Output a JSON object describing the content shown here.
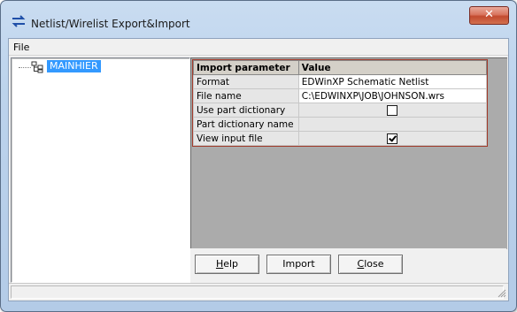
{
  "window": {
    "title": "Netlist/Wirelist Export&Import",
    "close_label": "✕"
  },
  "menu": {
    "items": [
      {
        "label": "File"
      }
    ]
  },
  "tree": {
    "nodes": [
      {
        "label": "MAINHIER",
        "selected": true,
        "icon": "hierarchy-icon"
      }
    ]
  },
  "grid": {
    "columns": [
      "Import parameter",
      "Value"
    ],
    "rows": [
      {
        "name": "Format",
        "value": "EDWinXP Schematic Netlist"
      },
      {
        "name": "File name",
        "value": "C:\\EDWINXP\\JOB\\JOHNSON.wrs"
      },
      {
        "name": "Use part dictionary",
        "checkbox": false
      },
      {
        "name": "Part dictionary name",
        "value": ""
      },
      {
        "name": "View input file",
        "checkbox": true
      }
    ]
  },
  "buttons": {
    "help": {
      "label": "Help",
      "mnemonic": "H",
      "rest": "elp"
    },
    "import": {
      "label": "Import"
    },
    "close": {
      "label": "Close",
      "mnemonic": "C",
      "rest": "lose"
    }
  },
  "colors": {
    "selection": "#3399ff",
    "grid_border": "#a13a2a",
    "panel_bg": "#ababab"
  }
}
